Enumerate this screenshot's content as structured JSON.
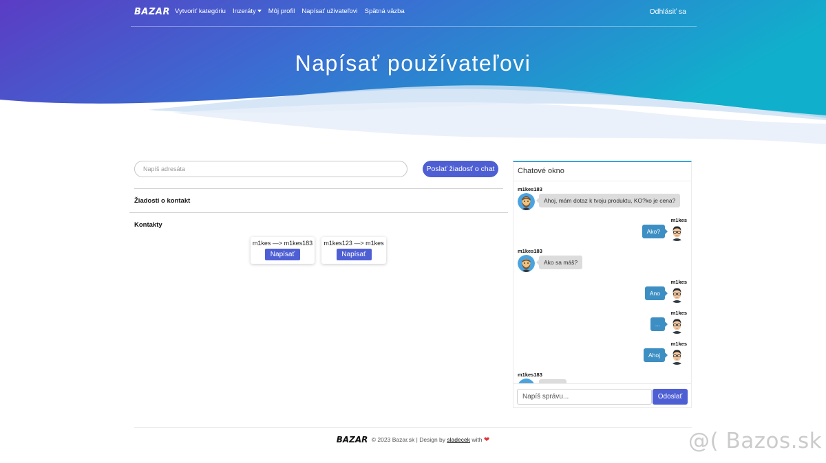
{
  "nav": {
    "brand": "BAZAR",
    "links": [
      "Vytvoriť kategóriu",
      "Inzeráty",
      "Môj profil",
      "Napísať uživateľovi",
      "Spätná väzba"
    ],
    "logout": "Odhlásiť sa"
  },
  "hero": {
    "title": "Napísať používateľovi"
  },
  "recipient": {
    "placeholder": "Napíš adresáta",
    "button": "Poslať žiadosť o chat"
  },
  "requests": {
    "title": "Žiadosti o kontakt"
  },
  "contacts": {
    "title": "Kontakty",
    "items": [
      {
        "label": "m1kes —> m1kes183",
        "button": "Napísať"
      },
      {
        "label": "m1kes123 —> m1kes",
        "button": "Napísať"
      }
    ]
  },
  "chat": {
    "title": "Chatové okno",
    "messages": [
      {
        "name": "m1kes183",
        "text": "Ahoj, mám dotaz k tvoju produktu, KO?ko je cena?",
        "direction": "in"
      },
      {
        "name": "m1kes",
        "text": "Ako?",
        "direction": "out"
      },
      {
        "name": "m1kes183",
        "text": "Ako sa máš?",
        "direction": "in"
      },
      {
        "name": "m1kes",
        "text": "Ano",
        "direction": "out"
      },
      {
        "name": "m1kes",
        "text": "...",
        "direction": "out"
      },
      {
        "name": "m1kes",
        "text": "Ahoj",
        "direction": "out"
      },
      {
        "name": "m1kes183",
        "text": "",
        "direction": "in"
      }
    ],
    "input_placeholder": "Napíš správu...",
    "send": "Odoslať"
  },
  "footer": {
    "brand": "BAZAR",
    "text": "© 2023 Bazar.sk | Design by",
    "author": "sladecek",
    "with": "with"
  },
  "watermark": "@( Bazos.sk",
  "colors": {
    "accent": "#4e5fd4",
    "chat_out": "#3d8fc3",
    "hero_start": "#5b3cc4",
    "hero_end": "#10b0cc",
    "heart": "#e0313a"
  }
}
